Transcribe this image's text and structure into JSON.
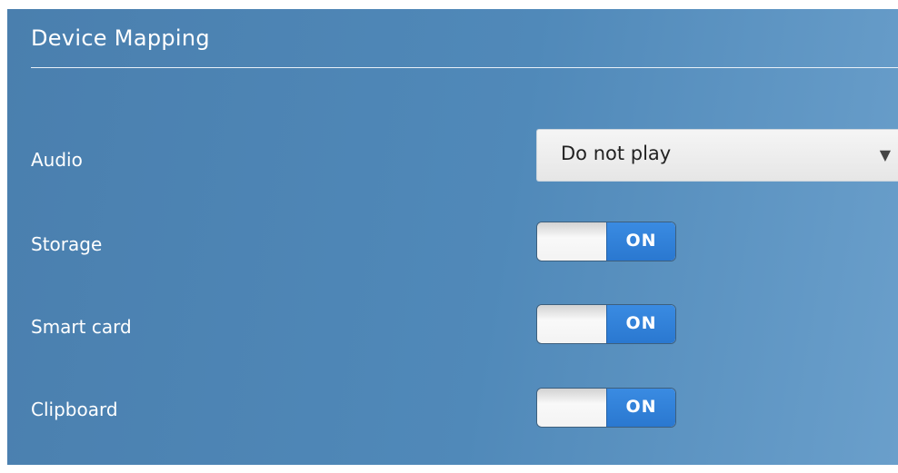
{
  "header": {
    "title": "Device Mapping"
  },
  "rows": {
    "audio": {
      "label": "Audio",
      "dropdown_value": "Do not play",
      "dropdown_arrow": "▼"
    },
    "storage": {
      "label": "Storage",
      "toggle_state": "ON"
    },
    "smart_card": {
      "label": "Smart card",
      "toggle_state": "ON"
    },
    "clipboard": {
      "label": "Clipboard",
      "toggle_state": "ON"
    }
  },
  "colors": {
    "panel_background": "#5089b9",
    "toggle_on": "#2f7fd8",
    "toggle_off": "#f3f3f3",
    "text": "#ffffff"
  }
}
